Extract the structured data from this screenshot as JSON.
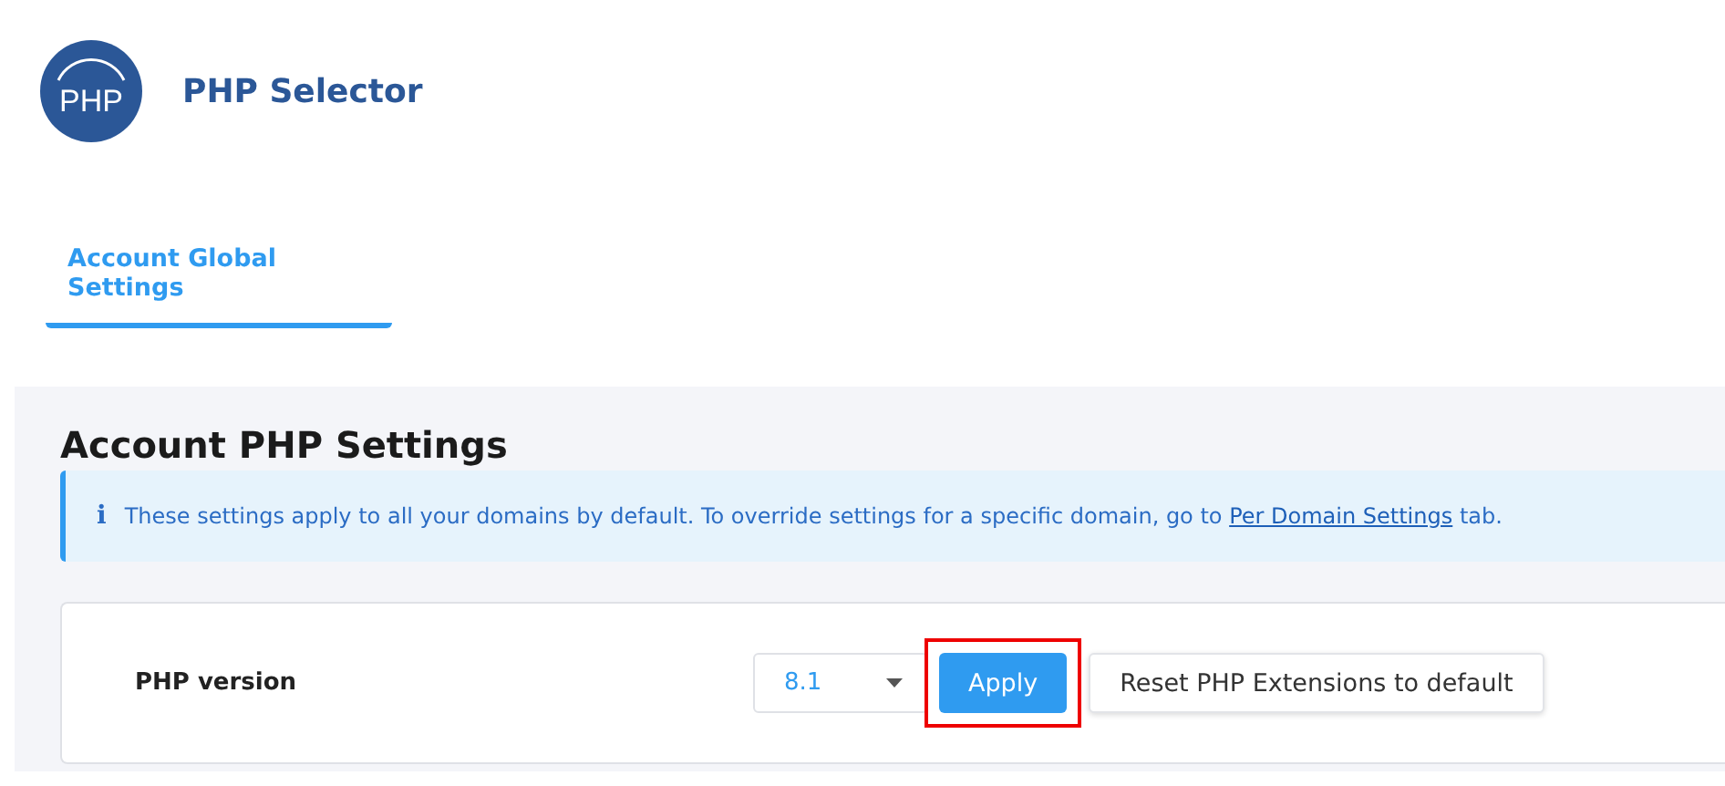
{
  "header": {
    "logo_text": "PHP",
    "title": "PHP Selector"
  },
  "tabs": [
    {
      "label": "Account Global Settings",
      "selected": true
    }
  ],
  "section": {
    "heading": "Account PHP Settings",
    "info": {
      "icon": "i",
      "text_before": "These settings apply to all your domains by default. To override settings for a specific domain, go to ",
      "link": "Per Domain Settings",
      "text_after": " tab."
    },
    "setting": {
      "label": "PHP version",
      "value": "8.1"
    },
    "buttons": [
      {
        "label": "Apply",
        "kind": "primary",
        "highlighted": true
      },
      {
        "label": "Reset PHP Extensions to default",
        "kind": "secondary",
        "highlighted": false
      }
    ]
  }
}
